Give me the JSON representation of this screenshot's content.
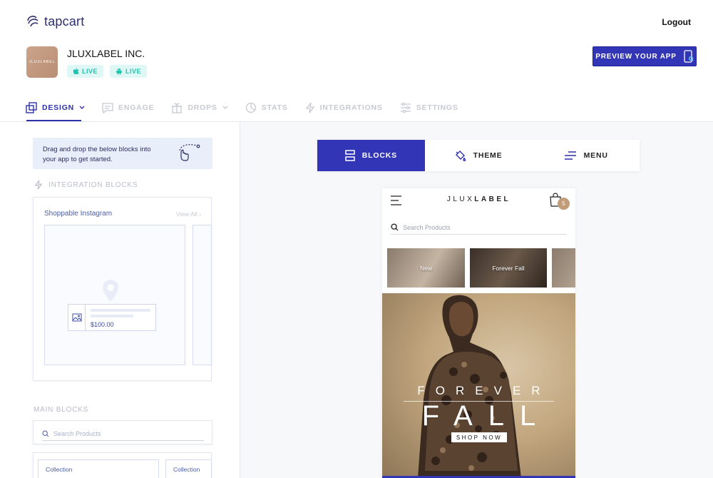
{
  "header": {
    "logo_text": "tapcart",
    "logout_label": "Logout",
    "brand_name": "JLUXLABEL INC.",
    "brand_thumb_text": "JLUXLABEL",
    "ios_status": "LIVE",
    "android_status": "LIVE",
    "preview_label": "PREVIEW YOUR APP"
  },
  "nav": {
    "items": [
      {
        "label": "DESIGN",
        "icon": "design-icon",
        "active": true
      },
      {
        "label": "ENGAGE",
        "icon": "engage-icon"
      },
      {
        "label": "DROPS",
        "icon": "drops-icon"
      },
      {
        "label": "STATS",
        "icon": "stats-icon"
      },
      {
        "label": "INTEGRATIONS",
        "icon": "integrations-icon"
      },
      {
        "label": "SETTINGS",
        "icon": "settings-icon"
      }
    ]
  },
  "left": {
    "hint_line1": "Drag and drop the below blocks into",
    "hint_line2": "your app to get started.",
    "integration_label": "INTEGRATION BLOCKS",
    "instagram_title": "Shoppable Instagram",
    "view_all": "View All",
    "price": "$100.00",
    "main_label": "MAIN BLOCKS",
    "search_placeholder": "Search Products",
    "collection_1": "Collection",
    "collection_2": "Collection"
  },
  "tabs": {
    "blocks": "BLOCKS",
    "theme": "THEME",
    "menu": "MENU"
  },
  "phone": {
    "logo_light": "JLUX",
    "logo_bold": "LABEL",
    "cart_count": "5",
    "search_placeholder": "Search Products",
    "categories": [
      "New",
      "Forever Fall"
    ],
    "hero_title_1": "FOREVER",
    "hero_title_2": "FALL",
    "hero_cta": "SHOP NOW"
  },
  "colors": {
    "primary": "#3235b5",
    "live_bg": "#dff8f6",
    "live_text": "#1ec4b0",
    "hint_bg": "#e8effb"
  }
}
